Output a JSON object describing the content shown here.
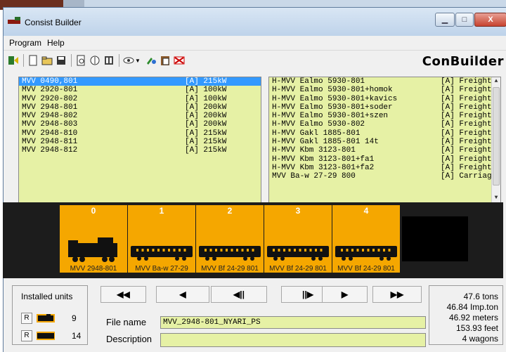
{
  "window": {
    "title": "Consist Builder"
  },
  "menu": [
    "Program",
    "Help"
  ],
  "toolbar": {
    "brand": "ConBuilder"
  },
  "locomotives": [
    {
      "name": "MVV 0490,801",
      "power": "[A] 215kW",
      "selected": true
    },
    {
      "name": "MVV 2920-801",
      "power": "[A] 100kW"
    },
    {
      "name": "MVV 2920-802",
      "power": "[A] 100kW"
    },
    {
      "name": "MVV 2948-801",
      "power": "[A] 200kW"
    },
    {
      "name": "MVV 2948-802",
      "power": "[A] 200kW"
    },
    {
      "name": "MVV 2948-803",
      "power": "[A] 200kW"
    },
    {
      "name": "MVV 2948-810",
      "power": "[A] 215kW"
    },
    {
      "name": "MVV 2948-811",
      "power": "[A] 215kW"
    },
    {
      "name": "MVV 2948-812",
      "power": "[A] 215kW"
    }
  ],
  "wagons": [
    {
      "name": "H-MVV Ealmo 5930-801",
      "type": "[A] Freight"
    },
    {
      "name": "H-MVV Ealmo 5930-801+homok",
      "type": "[A] Freight"
    },
    {
      "name": "H-MVV Ealmo 5930-801+kavics",
      "type": "[A] Freight"
    },
    {
      "name": "H-MVV Ealmo 5930-801+soder",
      "type": "[A] Freight"
    },
    {
      "name": "H-MVV Ealmo 5930-801+szen",
      "type": "[A] Freight"
    },
    {
      "name": "H-MVV Ealmo 5930-802",
      "type": "[A] Freight"
    },
    {
      "name": "H-MVV Gakl 1885-801",
      "type": "[A] Freight"
    },
    {
      "name": "H-MVV Gakl 1885-801 14t",
      "type": "[A] Freight"
    },
    {
      "name": "H-MVV Kbm 3123-801",
      "type": "[A] Freight"
    },
    {
      "name": "H-MVV Kbm 3123-801+fa1",
      "type": "[A] Freight"
    },
    {
      "name": "H-MVV Kbm 3123-801+fa2",
      "type": "[A] Freight"
    },
    {
      "name": "MVV Ba-w 27-29 800",
      "type": "[A] Carriage"
    }
  ],
  "consist": [
    {
      "index": "0",
      "label": "MVV 2948-801",
      "kind": "loco"
    },
    {
      "index": "1",
      "label": "MVV Ba-w 27-29",
      "kind": "car"
    },
    {
      "index": "2",
      "label": "MVV Bf 24-29 801",
      "kind": "car"
    },
    {
      "index": "3",
      "label": "MVV Bf 24-29 801",
      "kind": "car"
    },
    {
      "index": "4",
      "label": "MVV Bf 24-29 801",
      "kind": "car"
    }
  ],
  "installed": {
    "title": "Installed units",
    "loco_count": "9",
    "wagon_count": "14",
    "r_label": "R"
  },
  "nav": [
    "◀◀",
    "◀",
    "◀||",
    "||▶",
    "▶",
    "▶▶"
  ],
  "file": {
    "name_label": "File name",
    "name_value": "MVV_2948-801_NYARI_PS",
    "desc_label": "Description",
    "desc_value": ""
  },
  "stats": {
    "tons": "47.6 tons",
    "imp_ton": "46.84 Imp.ton",
    "meters": "46.92 meters",
    "feet": "153.93 feet",
    "wagons": "4 wagons"
  },
  "colors": {
    "list_bg": "#e6f1a5",
    "slot": "#f5a700",
    "selection": "#3399ff"
  }
}
